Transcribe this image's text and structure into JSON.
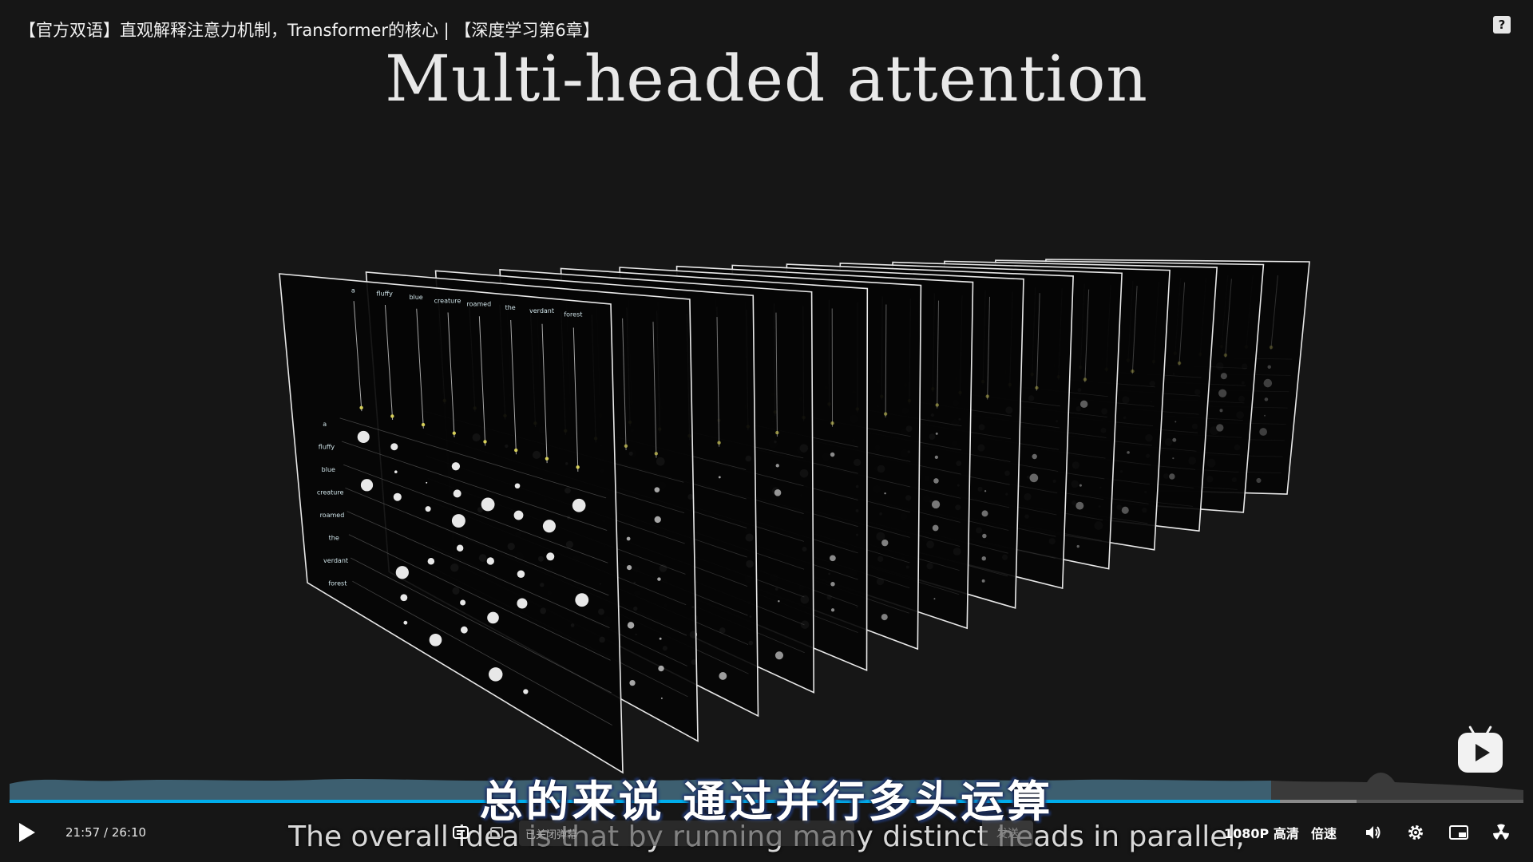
{
  "video": {
    "title": "【官方双语】直观解释注意力机制，Transformer的核心 | 【深度学习第6章】",
    "slide_title": "Multi-headed attention",
    "subtitle_zh": "总的来说 通过并行多头运算",
    "subtitle_en": "The overall idea is that by running many distinct heads in parallel,"
  },
  "attention_grid": {
    "column_tokens": [
      "a",
      "fluffy",
      "blue",
      "creature",
      "roamed",
      "the",
      "verdant",
      "forest"
    ],
    "row_tokens": [
      "a",
      "fluffy",
      "blue",
      "creature",
      "roamed",
      "the",
      "verdant",
      "forest"
    ]
  },
  "player": {
    "current_time": "21:57",
    "separator": "/",
    "duration": "26:10",
    "progress_fraction": 0.8391,
    "buffered_fraction": 0.89,
    "danmaku_placeholder": "已关闭弹幕",
    "send_label": "发送",
    "quality_label": "1080P 高清",
    "speed_label": "倍速"
  },
  "colors": {
    "accent": "#00aeec",
    "background": "#161616",
    "waveform": "#3d5f70"
  },
  "icons": {
    "play": "play-icon",
    "help": "help-icon",
    "danmaku": "danmaku-toggle-icon",
    "volume": "volume-icon",
    "settings": "gear-icon",
    "pip": "picture-in-picture-icon",
    "more": "radiation-icon",
    "bilibili": "bilibili-tv-icon"
  }
}
